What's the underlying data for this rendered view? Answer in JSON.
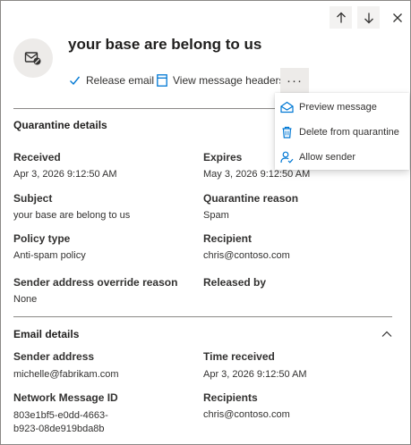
{
  "colors": {
    "accent": "#0078d4",
    "text": "#323130",
    "divider": "#8a8886",
    "avatar_bg": "#edebe9"
  },
  "nav": {
    "up_icon": "arrow-up-icon",
    "down_icon": "arrow-down-icon",
    "close_icon": "close-icon"
  },
  "header": {
    "title": "your base are belong to us",
    "avatar_icon": "mail-blocked-icon"
  },
  "actions": {
    "release_label": "Release email",
    "headers_label": "View message headers",
    "more_label": "···"
  },
  "menu": {
    "items": [
      {
        "label": "Preview message",
        "icon": "envelope-open-icon"
      },
      {
        "label": "Delete from quarantine",
        "icon": "trash-icon"
      },
      {
        "label": "Allow sender",
        "icon": "person-check-icon"
      }
    ]
  },
  "quarantine": {
    "title": "Quarantine details",
    "received_label": "Received",
    "received_value": "Apr 3, 2026 9:12:50 AM",
    "expires_label": "Expires",
    "expires_value": "May 3, 2026 9:12:50 AM",
    "subject_label": "Subject",
    "subject_value": "your base are belong to us",
    "reason_label": "Quarantine reason",
    "reason_value": "Spam",
    "policy_label": "Policy type",
    "policy_value": "Anti-spam policy",
    "recipient_label": "Recipient",
    "recipient_value": "chris@contoso.com",
    "override_label": "Sender address override reason",
    "override_value": "None",
    "released_label": "Released by"
  },
  "email": {
    "title": "Email details",
    "sender_label": "Sender address",
    "sender_value": "michelle@fabrikam.com",
    "time_label": "Time received",
    "time_value": "Apr 3, 2026 9:12:50 AM",
    "msgid_label": "Network Message ID",
    "msgid_value": "803e1bf5-e0dd-4663-b923-08de919bda8b",
    "recipients_label": "Recipients",
    "recipients_value": "chris@contoso.com"
  }
}
